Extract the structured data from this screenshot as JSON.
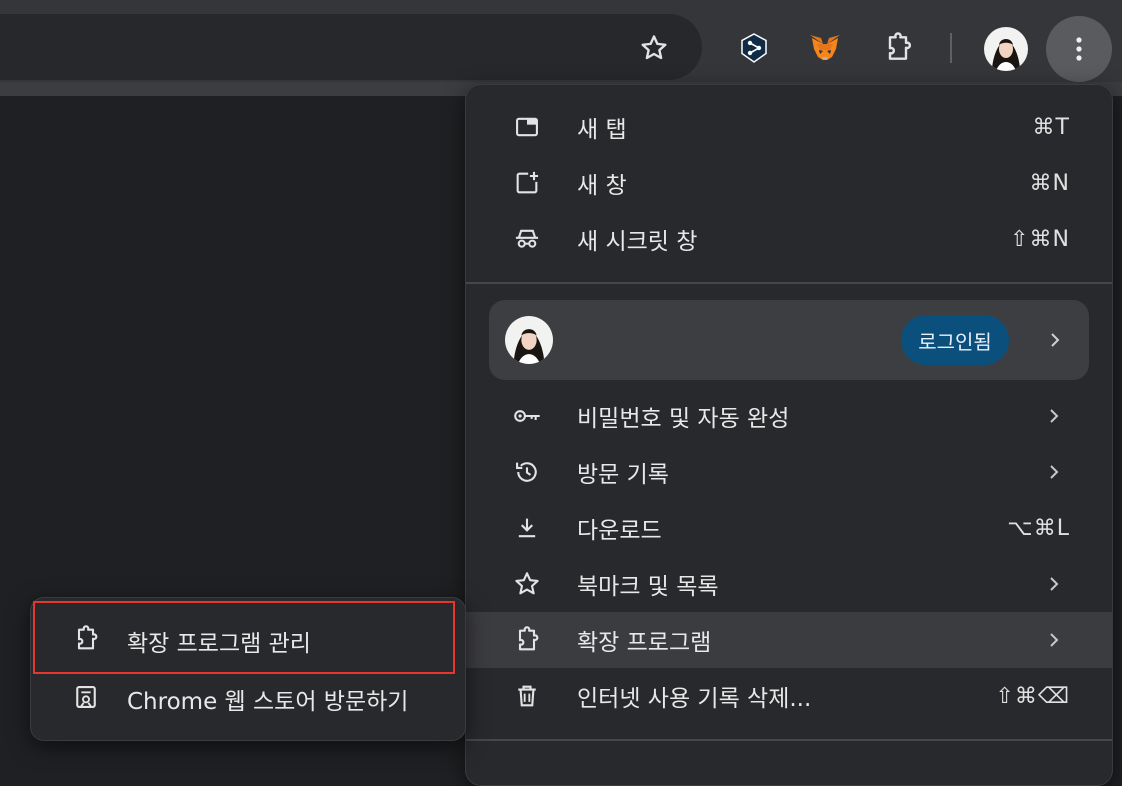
{
  "toolbar": {
    "bookmark_icon": "star-outline-icon",
    "extensions": [
      {
        "name": "DeepL",
        "icon": "deepl-extension-icon"
      },
      {
        "name": "MetaMask",
        "icon": "metamask-fox-icon"
      }
    ],
    "extensions_icon": "puzzle-piece-icon",
    "profile_icon": "profile-avatar-icon",
    "menu_icon": "kebab-menu-icon"
  },
  "menu": {
    "new_tab": {
      "label": "새 탭",
      "shortcut": "⌘T"
    },
    "new_window": {
      "label": "새 창",
      "shortcut": "⌘N"
    },
    "new_incognito": {
      "label": "새 시크릿 창",
      "shortcut": "⇧⌘N"
    },
    "profile": {
      "status": "로그인됨"
    },
    "passwords": {
      "label": "비밀번호 및 자동 완성"
    },
    "history": {
      "label": "방문 기록"
    },
    "downloads": {
      "label": "다운로드",
      "shortcut": "⌥⌘L"
    },
    "bookmarks": {
      "label": "북마크 및 목록"
    },
    "extensions": {
      "label": "확장 프로그램"
    },
    "clear_data": {
      "label": "인터넷 사용 기록 삭제...",
      "shortcut": "⇧⌘⌫"
    }
  },
  "submenu": {
    "manage_extensions": {
      "label": "확장 프로그램 관리"
    },
    "web_store": {
      "label": "Chrome 웹 스토어 방문하기"
    }
  },
  "colors": {
    "highlight": "#e5372c",
    "signed_in_badge": "#0b4f7c"
  }
}
